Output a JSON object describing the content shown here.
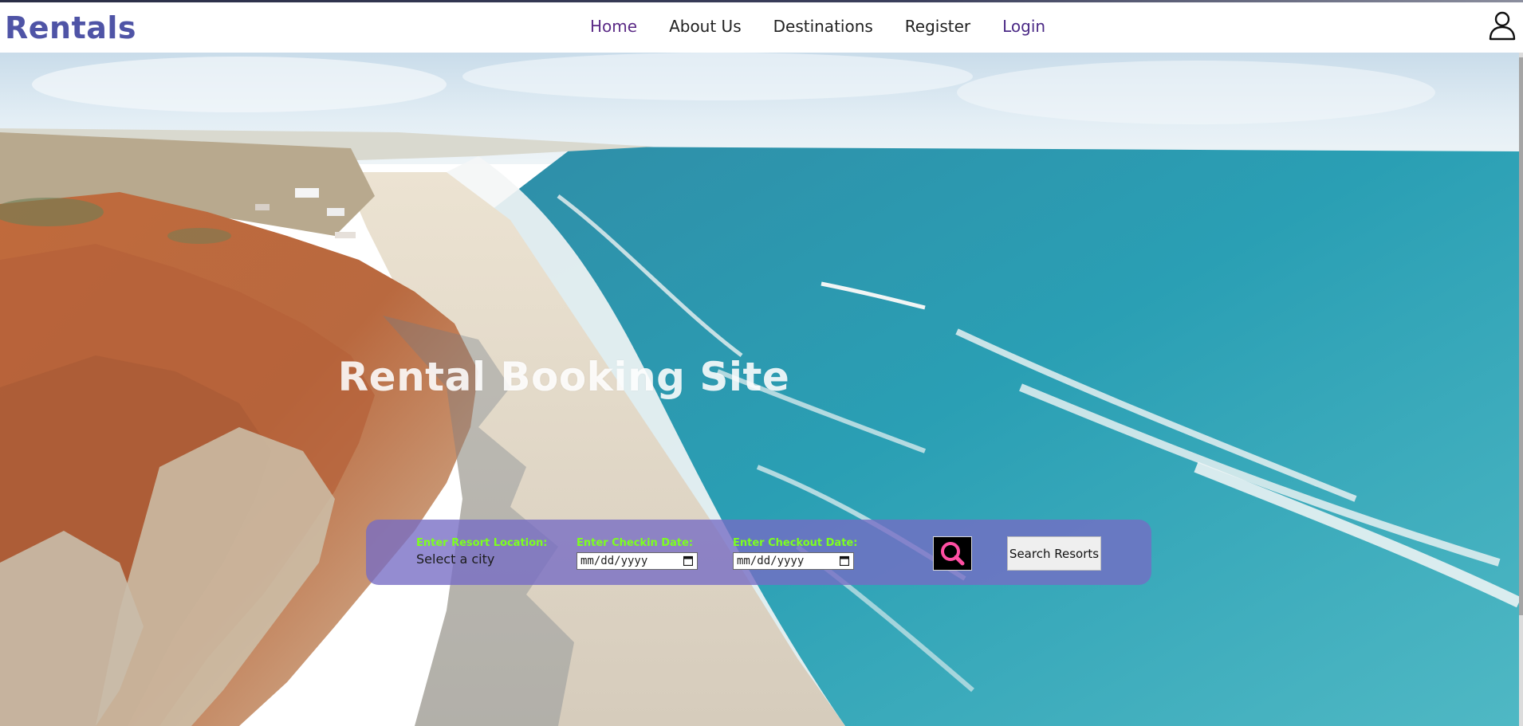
{
  "brand": {
    "name": "Rentals"
  },
  "nav": {
    "items": [
      {
        "label": "Home",
        "state": "active"
      },
      {
        "label": "About Us"
      },
      {
        "label": "Destinations"
      },
      {
        "label": "Register"
      },
      {
        "label": "Login"
      }
    ],
    "account_icon": "user-icon"
  },
  "hero": {
    "title": "Rental Booking Site"
  },
  "search": {
    "location_label": "Enter Resort Location:",
    "location_value": "Select a city",
    "checkin_label": "Enter Checkin Date:",
    "checkin_placeholder": "mm/dd/yyyy",
    "checkout_label": "Enter Checkout Date:",
    "checkout_placeholder": "mm/dd/yyyy",
    "search_icon": "search-icon",
    "button_label": "Search Resorts"
  },
  "colors": {
    "brand": "#4f54a6",
    "nav_active": "#5b2a86",
    "panel": "#766cc4",
    "label_green": "#7dff1f",
    "search_icon_pink": "#ff4fa3"
  }
}
